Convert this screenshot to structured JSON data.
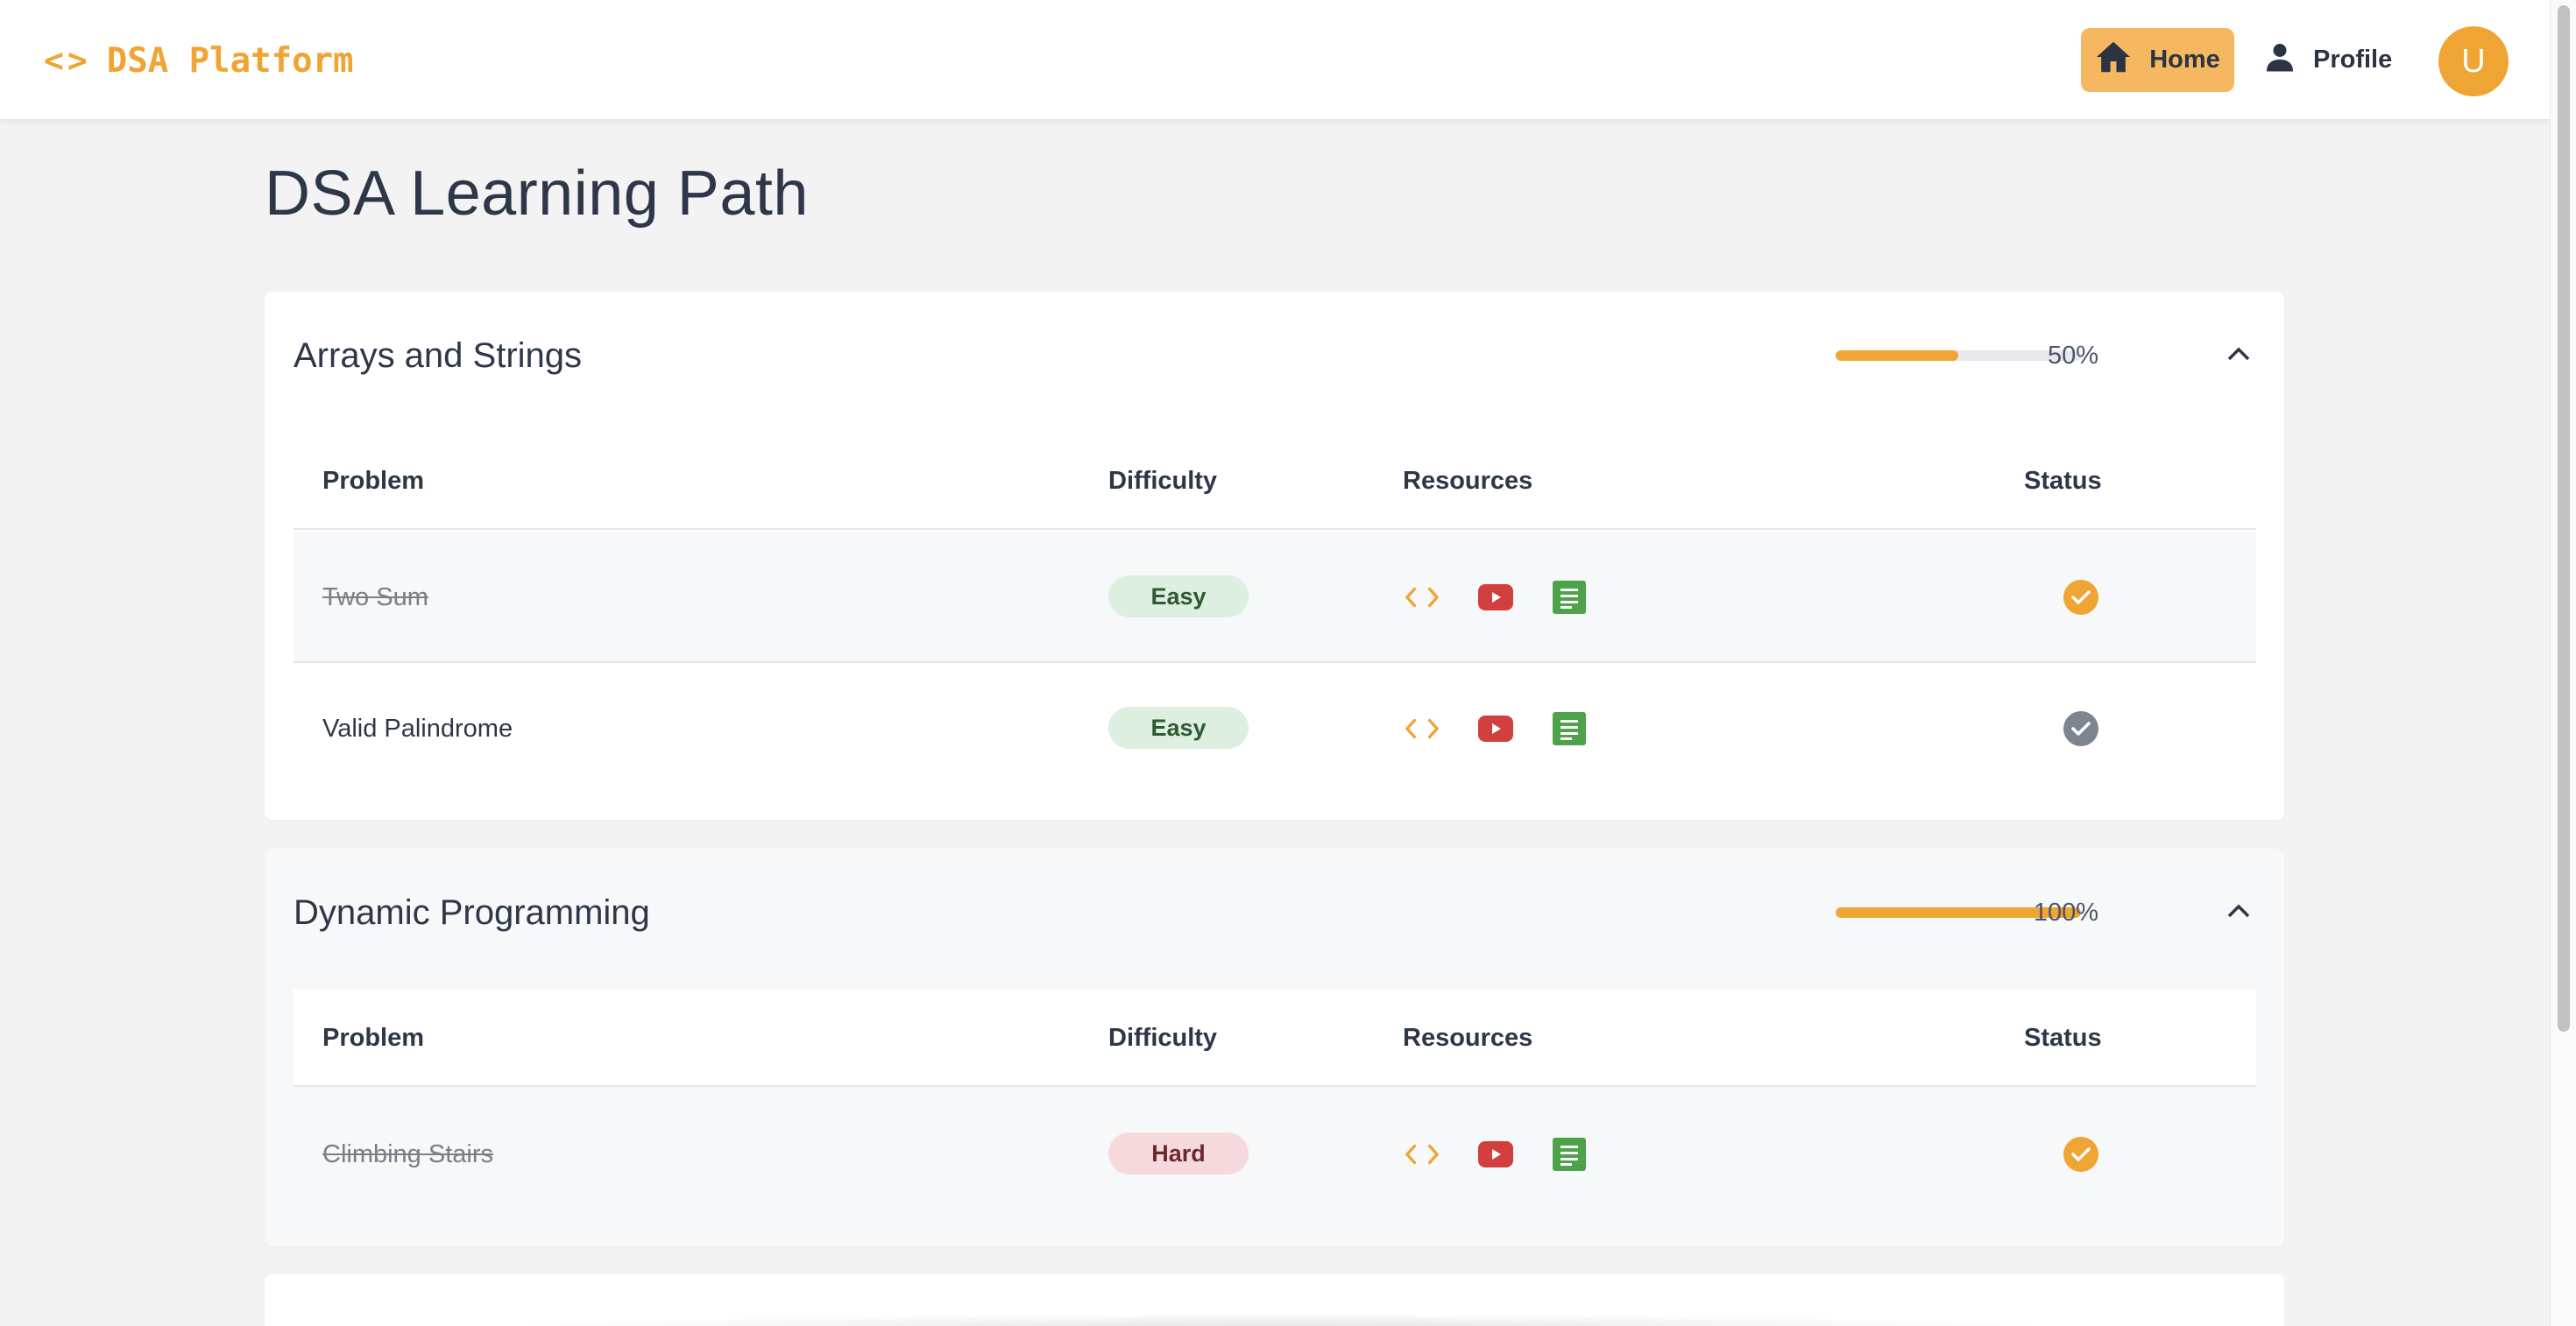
{
  "navbar": {
    "brand_icon": "<>",
    "brand_label": "DSA Platform",
    "home_label": "Home",
    "profile_label": "Profile",
    "avatar_initial": "U",
    "accent_color": "#f0a433"
  },
  "page": {
    "title": "DSA Learning Path"
  },
  "table_headers": {
    "problem": "Problem",
    "difficulty": "Difficulty",
    "resources": "Resources",
    "status": "Status"
  },
  "sections": [
    {
      "title": "Arrays and Strings",
      "progress": 50,
      "progress_label": "50%",
      "expanded": true,
      "problems": [
        {
          "name": "Two Sum",
          "difficulty": "Easy",
          "completed": true
        },
        {
          "name": "Valid Palindrome",
          "difficulty": "Easy",
          "completed": false
        }
      ]
    },
    {
      "title": "Dynamic Programming",
      "progress": 100,
      "progress_label": "100%",
      "expanded": true,
      "problems": [
        {
          "name": "Climbing Stairs",
          "difficulty": "Hard",
          "completed": true
        }
      ]
    }
  ],
  "icons": {
    "code": "code-icon",
    "youtube": "youtube-icon",
    "article": "article-icon",
    "status_done": "check-circle-icon",
    "collapse": "chevron-up-icon",
    "home": "home-icon",
    "profile": "person-icon"
  },
  "colors": {
    "easy_bg": "#dcefe0",
    "hard_bg": "#f6d9dc",
    "youtube": "#d23f3f",
    "article": "#4ea24a",
    "status_off": "#7d8590"
  }
}
